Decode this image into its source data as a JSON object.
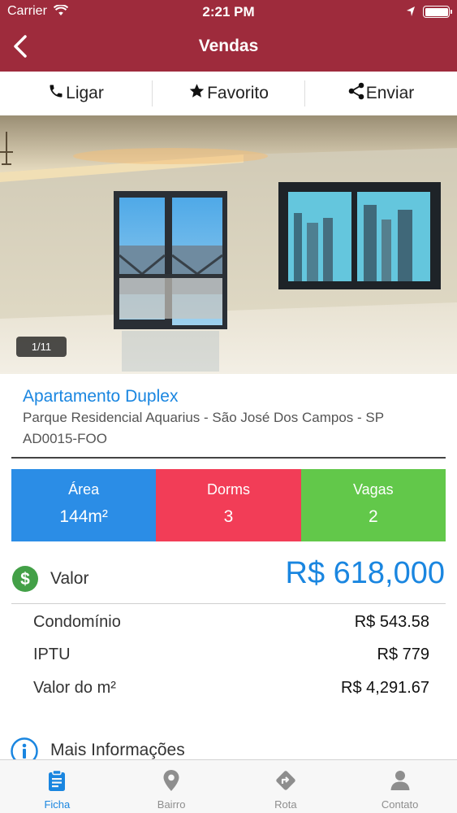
{
  "status_bar": {
    "carrier": "Carrier",
    "time": "2:21 PM"
  },
  "nav": {
    "title": "Vendas"
  },
  "actions": [
    {
      "label": "Ligar",
      "icon": "phone-icon"
    },
    {
      "label": "Favorito",
      "icon": "star-icon"
    },
    {
      "label": "Enviar",
      "icon": "share-icon"
    }
  ],
  "photo": {
    "counter": "1/11"
  },
  "listing": {
    "title": "Apartamento Duplex",
    "address": "Parque Residencial Aquarius - São José Dos Campos - SP",
    "code": "AD0015-FOO"
  },
  "stats": [
    {
      "label": "Área",
      "value": "144m²",
      "color": "#2b8de6"
    },
    {
      "label": "Dorms",
      "value": "3",
      "color": "#f23d57"
    },
    {
      "label": "Vagas",
      "value": "2",
      "color": "#62c84a"
    }
  ],
  "valor": {
    "label": "Valor",
    "price": "R$ 618,000"
  },
  "details": [
    {
      "label": "Condomínio",
      "value": "R$ 543.58"
    },
    {
      "label": "IPTU",
      "value": "R$ 779"
    },
    {
      "label": "Valor do m²",
      "value": "R$ 4,291.67"
    }
  ],
  "more_info": {
    "label": "Mais Informações"
  },
  "tabs": [
    {
      "label": "Ficha",
      "icon": "clipboard-icon",
      "active": true
    },
    {
      "label": "Bairro",
      "icon": "map-pin-icon",
      "active": false
    },
    {
      "label": "Rota",
      "icon": "route-icon",
      "active": false
    },
    {
      "label": "Contato",
      "icon": "person-icon",
      "active": false
    }
  ],
  "colors": {
    "nav_bar": "#9e2b3c",
    "accent_blue": "#1a86e0",
    "valor_green": "#43a047"
  }
}
